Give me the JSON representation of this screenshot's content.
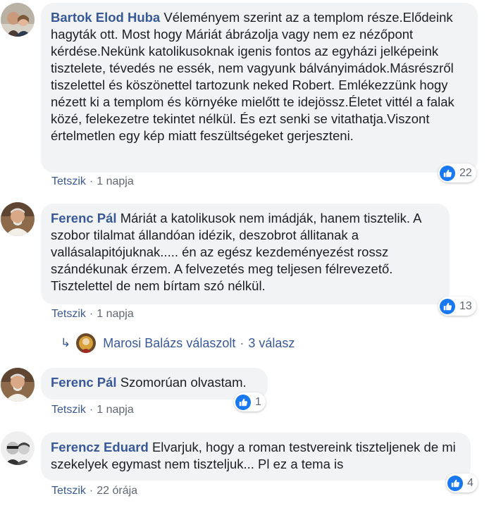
{
  "comments": [
    {
      "author": "Bartok Elod Huba",
      "text": "Véleményem szerint az a templom része.Elődeink hagyták ott. Most hogy Máriát ábrázolja vagy nem ez nézőpont kérdése.Nekünk katolikusoknak igenis fontos az egyházi jelképeink tisztelete, tévedés ne essék, nem vagyunk bálványimádok.Másrészről tiszelettel és köszönettel tartozunk neked Robert. Emlékezzünk hogy nézett ki a templom és környéke mielőtt te idejössz.Életet vittél a falak közé, felekezetre tekintet nélkül. És ezt senki se vitathatja.Viszont értelmetlen egy kép miatt feszültségeket gerjeszteni.",
      "like_label": "Tetszik",
      "time": "1 napja",
      "reactions": "22"
    },
    {
      "author": "Ferenc Pál",
      "text": "Máriát a katolikusok nem imádják, hanem tisztelik. A szobor tilalmat állandóan idézik, deszobrot állitanak a vallásalapitójuknak..... én az egész kezdeményezést rossz szándékunak érzem. A felvezetés meg teljesen félrevezető. Tisztelettel de nem bírtam szó nélkül.",
      "like_label": "Tetszik",
      "time": "1 napja",
      "reactions": "13",
      "replies": {
        "author": "Marosi Balázs",
        "action": "válaszolt",
        "count": "3 válasz"
      }
    },
    {
      "author": "Ferenc Pál",
      "text": "Szomorúan olvastam.",
      "like_label": "Tetszik",
      "time": "1 napja",
      "reactions": "1"
    },
    {
      "author": "Ferencz Eduard",
      "text": "Elvarjuk, hogy a roman testvereink tiszteljenek de mi szekelyek egymast nem tiszteljuk... Pl ez a tema is",
      "like_label": "Tetszik",
      "time": "22 órája",
      "reactions": "4"
    }
  ],
  "colors": {
    "author": "#385898",
    "bubble": "#f2f3f5",
    "meta": "#606770",
    "like_blue": "#1877f2"
  },
  "icons": {
    "like": "thumbs-up-icon",
    "reply": "reply-arrow-icon"
  }
}
